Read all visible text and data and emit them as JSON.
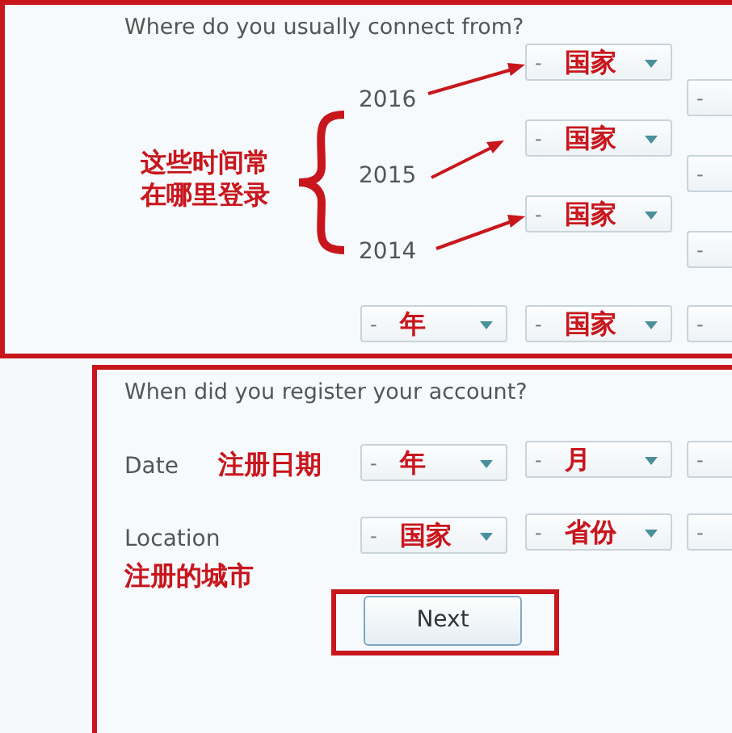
{
  "connect_section": {
    "title": "Where do you usually connect from?",
    "years": [
      {
        "label": "2016",
        "country": {
          "dash": "-",
          "value": "国家"
        },
        "province": {
          "dash": "-"
        }
      },
      {
        "label": "2015",
        "country": {
          "dash": "-",
          "value": "国家"
        },
        "province": {
          "dash": "-"
        }
      },
      {
        "label": "2014",
        "country": {
          "dash": "-",
          "value": "国家"
        },
        "province": {
          "dash": "-"
        }
      }
    ],
    "note": "这些时间常在哪里登录",
    "bottom_row": [
      {
        "dash": "-",
        "value": "年"
      },
      {
        "dash": "-",
        "value": "国家"
      },
      {
        "dash": "-"
      }
    ]
  },
  "register_section": {
    "title": "When did you register your account?",
    "date": {
      "label": "Date",
      "note": "注册日期",
      "selects": [
        {
          "dash": "-",
          "value": "年"
        },
        {
          "dash": "-",
          "value": "月"
        },
        {
          "dash": "-"
        }
      ]
    },
    "location": {
      "label": "Location",
      "note": "注册的城市",
      "selects": [
        {
          "dash": "-",
          "value": "国家"
        },
        {
          "dash": "-",
          "value": "省份"
        },
        {
          "dash": "-"
        }
      ]
    },
    "next_button": "Next"
  }
}
